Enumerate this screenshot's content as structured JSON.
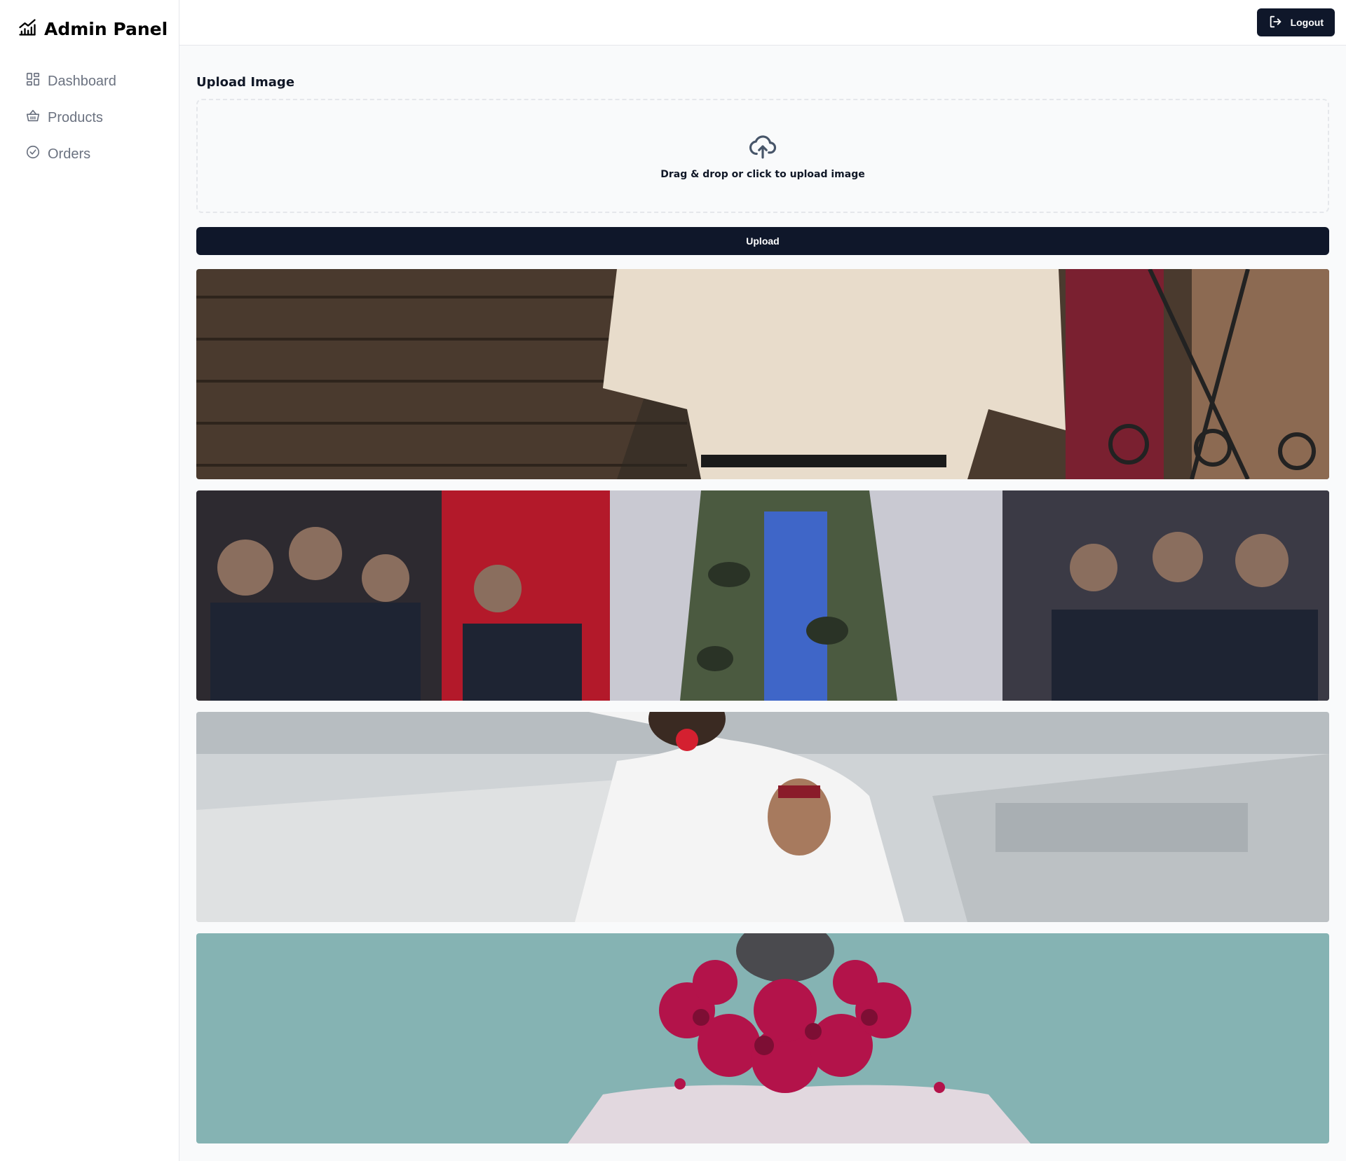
{
  "sidebar": {
    "brand": {
      "title": "Admin Panel",
      "icon": "chart-line-icon"
    },
    "items": [
      {
        "label": "Dashboard",
        "icon": "dashboard-grid-icon"
      },
      {
        "label": "Products",
        "icon": "basket-icon"
      },
      {
        "label": "Orders",
        "icon": "check-circle-icon"
      }
    ]
  },
  "header": {
    "logout_label": "Logout",
    "logout_icon": "logout-icon"
  },
  "upload": {
    "section_title": "Upload Image",
    "dropzone_text": "Drag & drop or click to upload image",
    "dropzone_icon": "cloud-upload-icon",
    "button_label": "Upload"
  },
  "gallery": {
    "images": [
      {
        "icon": "photo-beige-dress-brick-wall"
      },
      {
        "icon": "photo-runway-camo-jacket"
      },
      {
        "icon": "photo-white-shirt-red-earring"
      },
      {
        "icon": "photo-red-floral-collar-teal"
      }
    ]
  },
  "colors": {
    "primary": "#0f172a",
    "muted_text": "#6b7280",
    "border": "#e5e7eb",
    "background": "#f9fafb"
  }
}
